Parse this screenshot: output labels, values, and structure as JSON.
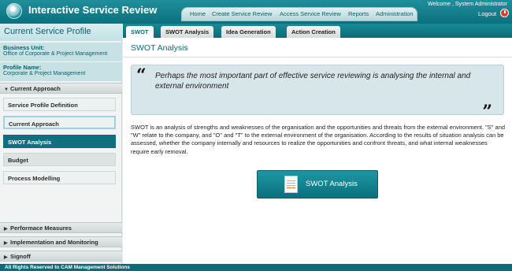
{
  "header": {
    "app_title": "Interactive Service Review",
    "welcome": "Welcome , System Administrator",
    "logout": "Logout",
    "nav": [
      "Home",
      "Create Service Review",
      "Access Service Review",
      "Reports",
      "Administration"
    ]
  },
  "sidebar": {
    "title": "Current Service Profile",
    "business_unit_label": "Business Unit:",
    "business_unit_value": "Office of Corporate & Project Management",
    "profile_name_label": "Profile Name:",
    "profile_name_value": "Corporate & Project Management",
    "current_approach_header": "Current Approach",
    "items": [
      "Service Profile Definition",
      "Current Approach",
      "SWOT Analysis",
      "Budget",
      "Process Modelling"
    ],
    "bottom_sections": [
      "Performace Measures",
      "Implementation and Monitoring",
      "Signoff"
    ]
  },
  "tabs": [
    "SWOT",
    "SWOT Analysis",
    "Idea Generation",
    "Action Creation"
  ],
  "main": {
    "page_title": "SWOT Analysis",
    "quote": "Perhaps the most important part of effective service reviewing is analysing the internal and external environment",
    "body": "SWOT is an analysis of strengths and weaknesses of the organisation and the opportunities and threats from the external environment. \"S\" and \"W\" relate to the company, and \"O\" and \"T\" to the external environment of the organisation. According to the results of situation analysis can be assessed, whether the company internally and resources to realize the opportunities and confront threats, and what internal weaknesses require early removal.",
    "button_label": "SWOT Analysis"
  },
  "footer": "All Rights Reserved to CAM Management Solutions",
  "colors": {
    "primary": "#0c6b78",
    "active_item": "#0f6f7e",
    "quote_bg": "#d7e6ea"
  },
  "icons": {
    "logo": "logo-icon",
    "logout": "power-icon",
    "button": "document-icon"
  }
}
